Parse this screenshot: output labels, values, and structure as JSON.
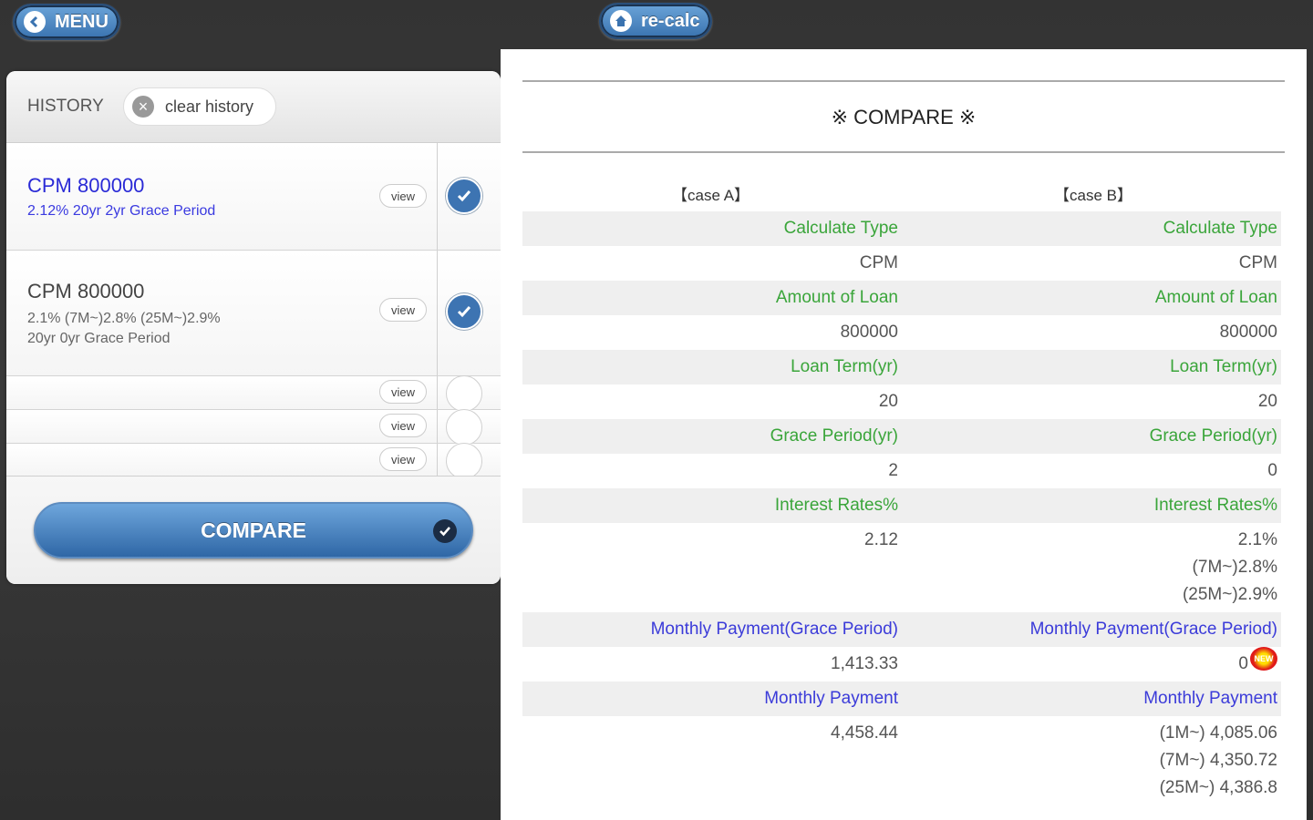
{
  "topbar": {
    "menu_label": "MENU",
    "recalc_label": "re-calc"
  },
  "history": {
    "title": "HISTORY",
    "clear_label": "clear history",
    "view_label": "view",
    "items": [
      {
        "title": "CPM 800000",
        "line1": "2.12% 20yr 2yr Grace Period",
        "line2": "",
        "checked": true,
        "color": "#2a2ad6"
      },
      {
        "title": "CPM 800000",
        "line1": "2.1% (7M~)2.8% (25M~)2.9%",
        "line2": "20yr 0yr Grace Period",
        "checked": true,
        "color": "#444444"
      }
    ],
    "compare_label": "COMPARE"
  },
  "compare": {
    "title": "※ COMPARE ※",
    "case_a": "【case A】",
    "case_b": "【case B】",
    "rows": {
      "calc_type": {
        "label": "Calculate Type",
        "a": "CPM",
        "b": "CPM"
      },
      "amount": {
        "label": "Amount of Loan",
        "a": "800000",
        "b": "800000"
      },
      "term": {
        "label": "Loan Term(yr)",
        "a": "20",
        "b": "20"
      },
      "grace": {
        "label": "Grace Period(yr)",
        "a": "2",
        "b": "0"
      },
      "rates": {
        "label": "Interest Rates%",
        "a": "2.12",
        "b1": "2.1%",
        "b2": "(7M~)2.8%",
        "b3": "(25M~)2.9%"
      },
      "monthly_grace": {
        "label": "Monthly Payment(Grace Period)",
        "a": "1,413.33",
        "b": "0",
        "b_badge": "NEW"
      },
      "monthly": {
        "label": "Monthly Payment",
        "a": "4,458.44",
        "b1": "(1M~) 4,085.06",
        "b2": "(7M~) 4,350.72",
        "b3": "(25M~) 4,386.8"
      }
    }
  }
}
